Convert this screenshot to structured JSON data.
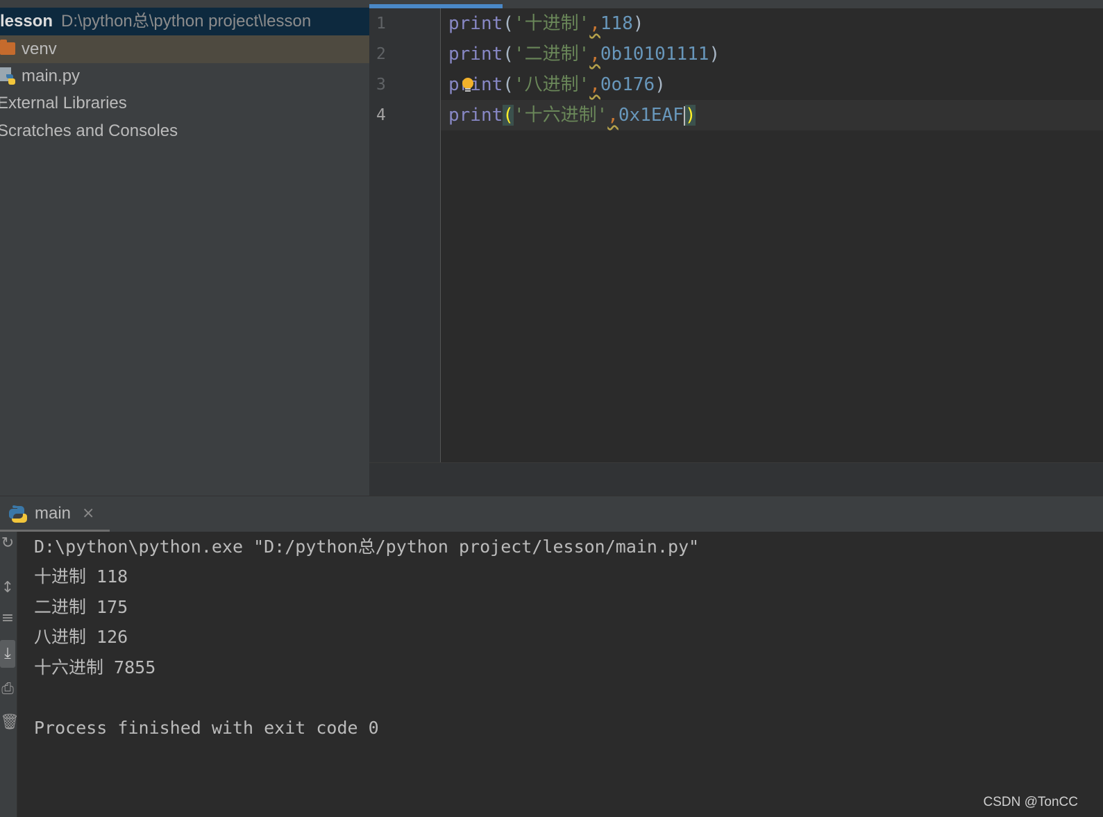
{
  "project_tree": {
    "root_name": "lesson",
    "root_path": "D:\\python总\\python project\\lesson",
    "items": [
      {
        "label": "venv",
        "icon": "folder-icon"
      },
      {
        "label": "main.py",
        "icon": "python-file-icon"
      },
      {
        "label": "External Libraries"
      },
      {
        "label": "Scratches and Consoles"
      }
    ]
  },
  "editor": {
    "line_numbers": [
      "1",
      "2",
      "3",
      "4"
    ],
    "lines": [
      {
        "fn": "print",
        "open": "(",
        "str": "'十进制'",
        "comma": ",",
        "num": "118",
        "close": ")"
      },
      {
        "fn": "print",
        "open": "(",
        "str": "'二进制'",
        "comma": ",",
        "num": "0b10101111",
        "close": ")"
      },
      {
        "fn": "print",
        "open": "(",
        "str": "'八进制'",
        "comma": ",",
        "num": "0o176",
        "close": ")"
      },
      {
        "fn": "print",
        "open": "(",
        "str": "'十六进制'",
        "comma": ",",
        "num": "0x1EAF",
        "close": ")"
      }
    ]
  },
  "run_panel": {
    "tab_label": "main",
    "close_glyph": "×",
    "console_lines": [
      "D:\\python\\python.exe \"D:/python总/python project/lesson/main.py\"",
      "十进制 118",
      "二进制 175",
      "八进制 126",
      "十六进制 7855",
      "",
      "Process finished with exit code 0"
    ]
  },
  "watermark": "CSDN @TonCC",
  "colors": {
    "keyword": "#8888c6",
    "string": "#6a8759",
    "number": "#6897bb",
    "comma": "#cc7832",
    "background": "#2b2b2b",
    "panel": "#3c3f41"
  }
}
